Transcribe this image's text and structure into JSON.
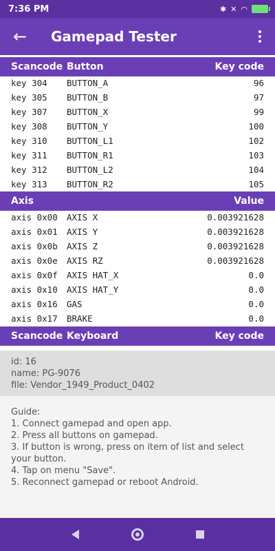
{
  "status_bar": {
    "time": "7:36 PM",
    "icons": [
      "notification-icon",
      "signal-icon",
      "bluetooth-icon",
      "mute-icon",
      "location-off-icon",
      "wifi-icon",
      "battery-icon"
    ]
  },
  "app_bar": {
    "title": "Gamepad Tester"
  },
  "buttons_section": {
    "headers": [
      "Scancode",
      "Button",
      "Key code"
    ],
    "rows": [
      [
        "key 304",
        "BUTTON_A",
        "96"
      ],
      [
        "key 305",
        "BUTTON_B",
        "97"
      ],
      [
        "key 307",
        "BUTTON_X",
        "99"
      ],
      [
        "key 308",
        "BUTTON_Y",
        "100"
      ],
      [
        "key 310",
        "BUTTON_L1",
        "102"
      ],
      [
        "key 311",
        "BUTTON_R1",
        "103"
      ],
      [
        "key 312",
        "BUTTON_L2",
        "104"
      ],
      [
        "key 313",
        "BUTTON_R2",
        "105"
      ]
    ]
  },
  "axis_section": {
    "headers": [
      "Axis",
      "Value"
    ],
    "rows": [
      [
        "axis 0x00",
        "AXIS X",
        "0.003921628"
      ],
      [
        "axis 0x01",
        "AXIS Y",
        "0.003921628"
      ],
      [
        "axis 0x0b",
        "AXIS Z",
        "0.003921628"
      ],
      [
        "axis 0x0e",
        "AXIS RZ",
        "0.003921628"
      ],
      [
        "axis 0x0f",
        "AXIS HAT_X",
        "0.0"
      ],
      [
        "axis 0x10",
        "AXIS HAT_Y",
        "0.0"
      ],
      [
        "axis 0x16",
        "GAS",
        "0.0"
      ],
      [
        "axis 0x17",
        "BRAKE",
        "0.0"
      ]
    ]
  },
  "keyboard_section": {
    "headers": [
      "Scancode",
      "Keyboard",
      "Key code"
    ]
  },
  "device_info": {
    "id": "id: 16",
    "name": "name: PG-9076",
    "file": "file: Vendor_1949_Product_0402"
  },
  "guide": {
    "title": "Guide:",
    "steps": [
      "1. Connect gamepad and open app.",
      "2. Press all buttons on gamepad.",
      "3. If button is wrong, press on item of list and select your button.",
      "4. Tap on menu \"Save\".",
      "5. Reconnect gamepad or reboot Android."
    ]
  },
  "colors": {
    "primary": "#6a3fb5",
    "primary_dark": "#5a2fa0",
    "info_bg": "#dedede"
  }
}
